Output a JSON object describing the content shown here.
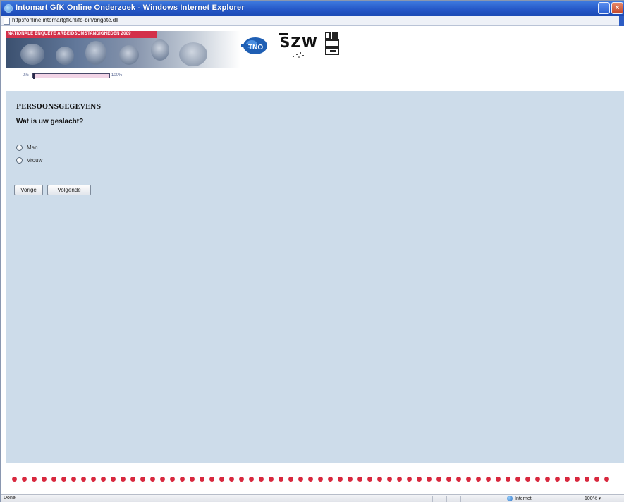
{
  "window": {
    "title": "Intomart GfK Online Onderzoek - Windows Internet Explorer",
    "minimize_glyph": "_",
    "close_glyph": "×"
  },
  "address": {
    "url": "http://online.intomartgfk.nl/fb-bin/brigate.dll"
  },
  "banner": {
    "strip_text": "NATIONALE ENQUÊTE ARBEIDSOMSTANDIGHEDEN 2009",
    "logos": [
      "tno-logo",
      "szw-logo",
      "cbs-logo"
    ],
    "szw_text": "SZW",
    "accent_color": "#d3304a"
  },
  "progress": {
    "min_label": "0%",
    "max_label": "100%",
    "value_percent": 0
  },
  "survey": {
    "section_title": "PERSOONSGEGEVENS",
    "question": "Wat is uw geslacht?",
    "options": [
      {
        "label": "Man",
        "selected": false
      },
      {
        "label": "Vrouw",
        "selected": false
      }
    ],
    "prev_label": "Vorige",
    "next_label": "Volgende"
  },
  "status": {
    "text": "Done",
    "zone": "Internet",
    "zoom": "100%",
    "zoom_arrow": "▾"
  },
  "colors": {
    "content_bg": "#cddcea",
    "dot_color": "#d8283e",
    "titlebar": "#2456c6"
  }
}
